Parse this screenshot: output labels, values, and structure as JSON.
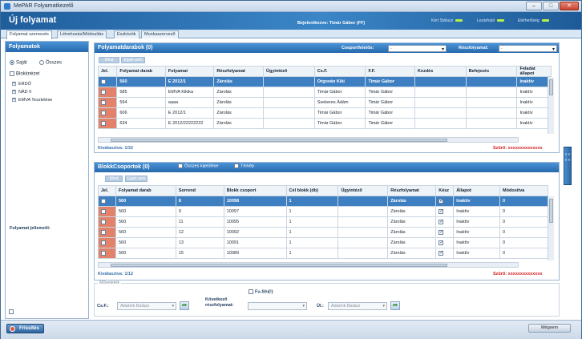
{
  "window": {
    "title": "MePAR Folyamatkezelő",
    "minimize": "–",
    "maximize": "□",
    "close": "✕"
  },
  "header": {
    "app_title": "Új folyamat",
    "login": "Bejelentkezve: Timár Gábor (FF)",
    "status": [
      {
        "label": "Kért Státusz",
        "color": "#b8f04a"
      },
      {
        "label": "Lezárható",
        "color": "#b8f04a"
      },
      {
        "label": "Elérhetőség",
        "color": "#b8f04a"
      }
    ]
  },
  "tabs": [
    "Folyamat szervezés",
    "Létrehozás/Módosítás",
    "Eszközök",
    "Munkaszervező"
  ],
  "left": {
    "title": "Folyamatok",
    "radio_own": "Saját",
    "radio_all": "Összes",
    "blokk": "Blokknézet",
    "tree": [
      "ERDŐ",
      "NÁD II",
      "EMVA Tesztelése"
    ],
    "jellemzoi": "Folyamat jellemzői:"
  },
  "top": {
    "title": "Folyamatdarabok (0)",
    "csoport_label": "Csoportfelelős:",
    "csoport_value": "-",
    "resz_label": "Részfolyamat:",
    "resz_value": "-",
    "btn_all": "Mind",
    "btn_none": "Egyik sem",
    "columns": [
      "Jel.",
      "Folyamat darab",
      "Folyamat",
      "Részfolyamat",
      "Ügyintéző",
      "Cs.F.",
      "F.F.",
      "Kezdés",
      "Befejezés",
      "Feladat állapot"
    ],
    "rows": [
      [
        "560",
        "E 2012/1",
        "Zárolás",
        "",
        "Orgován Kiki",
        "Timár Gábor",
        "",
        "",
        "Inaktív"
      ],
      [
        "585",
        "EMVA Kikika",
        "Zárolás",
        "",
        "Timár Gábor",
        "Timár Gábor",
        "",
        "",
        "Inaktív"
      ],
      [
        "594",
        "aaaa",
        "Zárolás",
        "",
        "Szekeres Ádám",
        "Timár Gábor",
        "",
        "",
        "Inaktív"
      ],
      [
        "606",
        "E 2012/1",
        "Zárolás",
        "",
        "Timár Gábor",
        "Timár Gábor",
        "",
        "",
        "Inaktív"
      ],
      [
        "634",
        "E 2012/22222222",
        "Zárolás",
        "",
        "Timár Gábor",
        "Timár Gábor",
        "",
        "",
        "Inaktív"
      ]
    ],
    "count": "Kiválasztva: 1/32",
    "szuro": "Szűrő: xxxxxxxxxxxxxx"
  },
  "bottom": {
    "title": "BlokkCsoportok (0)",
    "all_select": "Összes kijelölése",
    "terkep": "Térkép",
    "btn_all": "Mind",
    "btn_none": "Egyik sem",
    "columns": [
      "Jel.",
      "Folyamat darab",
      "Sorrend",
      "Blokk csoport",
      "Cél blokk (db)",
      "Ügyintéző",
      "Részfolyamat",
      "Kész",
      "Állapot",
      "Módosítva"
    ],
    "rows": [
      [
        "560",
        "8",
        "10098",
        "1",
        "",
        "Zárolás",
        "Inaktív",
        "0"
      ],
      [
        "560",
        "9",
        "10097",
        "1",
        "",
        "Zárolás",
        "Inaktív",
        "0"
      ],
      [
        "560",
        "11",
        "10095",
        "1",
        "",
        "Zárolás",
        "Inaktív",
        "0"
      ],
      [
        "560",
        "12",
        "10092",
        "1",
        "",
        "Zárolás",
        "Inaktív",
        "0"
      ],
      [
        "560",
        "13",
        "10091",
        "1",
        "",
        "Zárolás",
        "Inaktív",
        "0"
      ],
      [
        "560",
        "15",
        "10089",
        "1",
        "",
        "Zárolás",
        "Inaktív",
        "0"
      ]
    ],
    "count": "Kiválasztva: 1/12",
    "szuro": "Szűrő: xxxxxxxxxxxxxx"
  },
  "muveletek": {
    "legend": "Műveletek",
    "csf_label": "Cs.F.:",
    "csf_value": "Adamik Balázs",
    "fushi": "Fu-Shi(!)",
    "kov_label": "Következő részfolyamat:",
    "kov_value": "",
    "ul_label": "Ül.:",
    "ul_value": "Adamik Balázs"
  },
  "footer": {
    "frissites": "Frissítés",
    "megsem": "Mégsem"
  },
  "sidebtn": "» » » »"
}
